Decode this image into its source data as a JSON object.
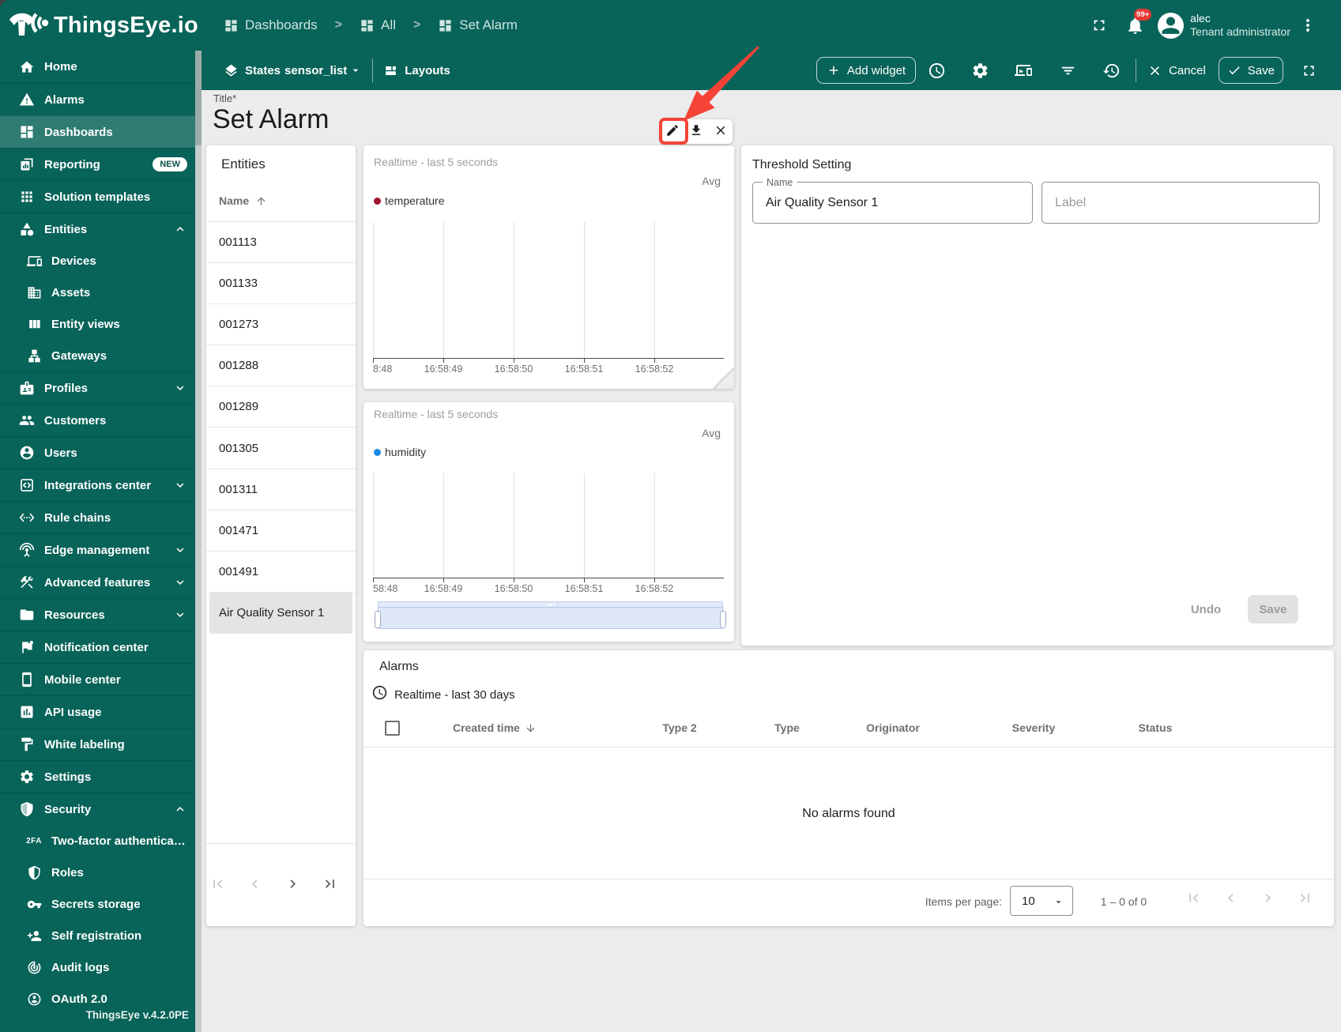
{
  "app": {
    "logo_text": "ThingsEye.io",
    "version": "ThingsEye v.4.2.0PE"
  },
  "header": {
    "breadcrumbs": [
      {
        "label": "Dashboards"
      },
      {
        "label": "All"
      },
      {
        "label": "Set Alarm"
      }
    ],
    "user": {
      "name": "alec",
      "role": "Tenant administrator",
      "notification_badge": "99+"
    }
  },
  "toolbar": {
    "states_label": "States",
    "state_value": "sensor_list",
    "layouts_label": "Layouts",
    "add_widget_label": "Add widget",
    "cancel_label": "Cancel",
    "save_label": "Save"
  },
  "sidebar": {
    "items": [
      {
        "label": "Home"
      },
      {
        "label": "Alarms"
      },
      {
        "label": "Dashboards",
        "selected": true
      },
      {
        "label": "Reporting",
        "badge": "NEW"
      },
      {
        "label": "Solution templates"
      },
      {
        "label": "Entities",
        "expanded": true
      },
      {
        "label": "Devices",
        "sub": true
      },
      {
        "label": "Assets",
        "sub": true
      },
      {
        "label": "Entity views",
        "sub": true
      },
      {
        "label": "Gateways",
        "sub": true
      },
      {
        "label": "Profiles",
        "expandable": true
      },
      {
        "label": "Customers"
      },
      {
        "label": "Users"
      },
      {
        "label": "Integrations center",
        "expandable": true
      },
      {
        "label": "Rule chains"
      },
      {
        "label": "Edge management",
        "expandable": true
      },
      {
        "label": "Advanced features",
        "expandable": true
      },
      {
        "label": "Resources",
        "expandable": true
      },
      {
        "label": "Notification center"
      },
      {
        "label": "Mobile center"
      },
      {
        "label": "API usage"
      },
      {
        "label": "White labeling"
      },
      {
        "label": "Settings"
      },
      {
        "label": "Security",
        "expanded": true
      },
      {
        "label": "Two-factor authenticati…",
        "sub": true
      },
      {
        "label": "Roles",
        "sub": true
      },
      {
        "label": "Secrets storage",
        "sub": true
      },
      {
        "label": "Self registration",
        "sub": true
      },
      {
        "label": "Audit logs",
        "sub": true
      },
      {
        "label": "OAuth 2.0",
        "sub": true
      }
    ]
  },
  "page": {
    "title_label": "Title*",
    "title": "Set Alarm"
  },
  "entities_panel": {
    "title": "Entities",
    "column": "Name",
    "rows": [
      "001113",
      "001133",
      "001273",
      "001288",
      "001289",
      "001305",
      "001311",
      "001471",
      "001491",
      "Air Quality Sensor 1"
    ],
    "selected_row": "Air Quality Sensor 1"
  },
  "chart_data": [
    {
      "type": "line",
      "title": "Realtime - last 5 seconds",
      "aggregation": "Avg",
      "series": [
        {
          "name": "temperature",
          "color": "#a1142f",
          "values": []
        }
      ],
      "x_tick_labels": [
        "8:48",
        "16:58:49",
        "16:58:50",
        "16:58:51",
        "16:58:52"
      ],
      "grid": "vertical-only",
      "legend_position": "top-left",
      "empty": true
    },
    {
      "type": "line",
      "title": "Realtime - last 5 seconds",
      "aggregation": "Avg",
      "series": [
        {
          "name": "humidity",
          "color": "#1e88e5",
          "values": []
        }
      ],
      "x_tick_labels": [
        "58:48",
        "16:58:49",
        "16:58:50",
        "16:58:51",
        "16:58:52"
      ],
      "grid": "vertical-only",
      "legend_position": "top-left",
      "has_datazoom_slider": true,
      "empty": true
    }
  ],
  "threshold": {
    "title": "Threshold Setting",
    "name_label": "Name",
    "name_value": "Air Quality Sensor 1",
    "label_placeholder": "Label",
    "undo_label": "Undo",
    "save_label": "Save"
  },
  "alarms": {
    "title": "Alarms",
    "timewindow": "Realtime - last 30 days",
    "columns": [
      "Created time",
      "Type 2",
      "Type",
      "Originator",
      "Severity",
      "Status"
    ],
    "empty_text": "No alarms found",
    "items_per_page_label": "Items per page:",
    "items_per_page": "10",
    "range_text": "1 – 0 of 0"
  },
  "colors": {
    "brand_green": "#086359",
    "annotation_red": "#f44336",
    "temperature_series": "#a1142f",
    "humidity_series": "#1e88e5"
  }
}
